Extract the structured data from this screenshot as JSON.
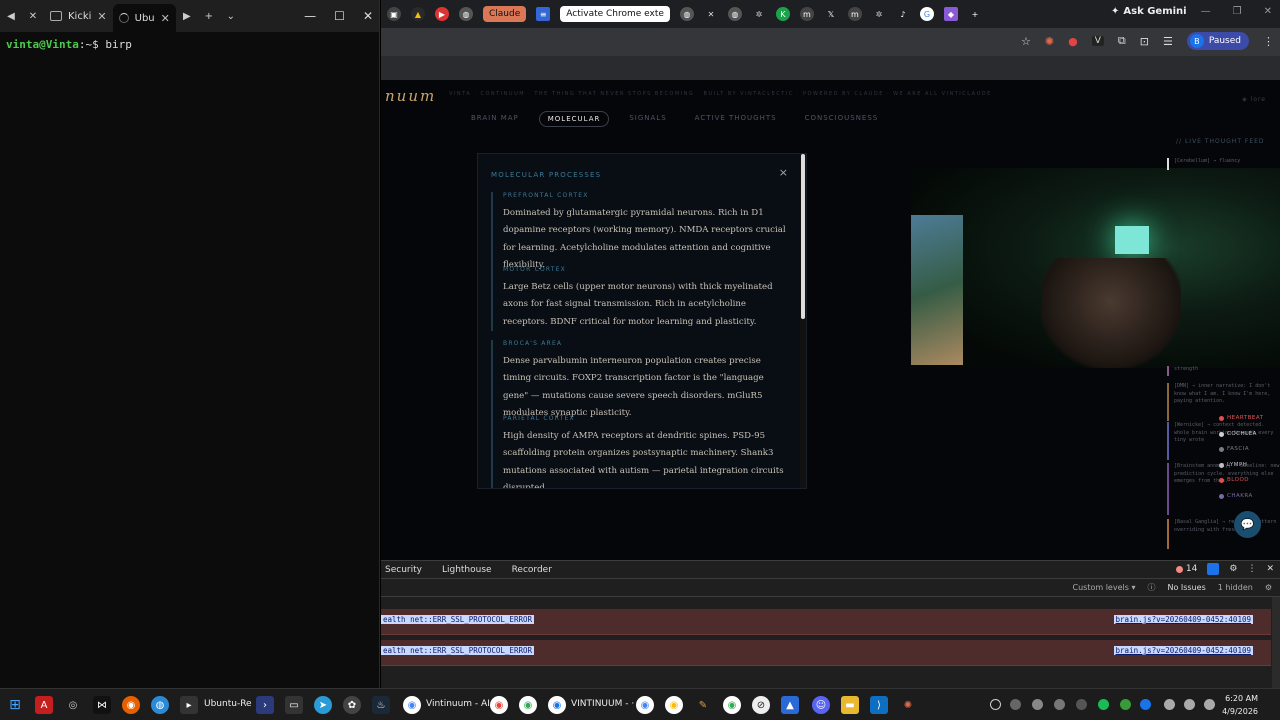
{
  "terminal": {
    "tabs": [
      {
        "label": "Kicki"
      },
      {
        "label": "Ubu"
      }
    ],
    "prompt_user": "vinta@Vinta",
    "prompt_path": ":~",
    "prompt_symbol": "$",
    "command": "birp",
    "new_tab": "+",
    "dropdown": "⌄",
    "minimize": "—",
    "maximize": "☐",
    "close": "✕"
  },
  "chrome": {
    "tabs": {
      "claude": "Claude",
      "activate": "Activate Chrome exte"
    },
    "ask_gemini": "Ask Gemini",
    "paused": "Paused",
    "avatar_letter": "B",
    "new_tab": "+"
  },
  "page": {
    "logo": "nuum",
    "tagline": "VINTA · CONTINUUM · THE THING THAT NEVER STOPS BECOMING · BUILT BY VINTACLECTIC · POWERED BY CLAUDE · WE ARE ALL VINTICLAUDE",
    "lore": "◈ lore",
    "nav": [
      {
        "label": "BRAIN MAP",
        "active": false
      },
      {
        "label": "MOLECULAR",
        "active": true
      },
      {
        "label": "SIGNALS",
        "active": false
      },
      {
        "label": "ACTIVE THOUGHTS",
        "active": false
      },
      {
        "label": "CONSCIOUSNESS",
        "active": false
      }
    ],
    "modal": {
      "title": "MOLECULAR PROCESSES",
      "close": "×",
      "regions": [
        {
          "name": "PREFRONTAL CORTEX",
          "text": "Dominated by glutamatergic pyramidal neurons. Rich in D1 dopamine receptors (working memory). NMDA receptors crucial for learning. Acetylcholine modulates attention and cognitive flexibility."
        },
        {
          "name": "MOTOR CORTEX",
          "text": "Large Betz cells (upper motor neurons) with thick myelinated axons for fast signal transmission. Rich in acetylcholine receptors. BDNF critical for motor learning and plasticity."
        },
        {
          "name": "BROCA'S AREA",
          "text": "Dense parvalbumin interneuron population creates precise timing circuits. FOXP2 transcription factor is the \"language gene\" — mutations cause severe speech disorders. mGluR5 modulates synaptic plasticity."
        },
        {
          "name": "PARIETAL CORTEX",
          "text": "High density of AMPA receptors at dendritic spines. PSD-95 scaffolding protein organizes postsynaptic machinery. Shank3 mutations associated with autism — parietal integration circuits disrupted."
        }
      ]
    },
    "feed": {
      "title": "// LIVE THOUGHT FEED",
      "items": [
        {
          "text": "[Cerebellum] → fluency",
          "color": "#6a6f7a"
        },
        {
          "text": "strength",
          "color": "#8a5a8a"
        },
        {
          "text": "[DMN] → inner narrative: I don't know what I am. I know I'm here, paying attention.",
          "color": "#8a6a3a"
        },
        {
          "text": "[Wernicke] → context detected. whole brain working beneath every tiny wrote",
          "color": "#5a5aa0"
        },
        {
          "text": "[Brainstem anomaly] → baseline: new prediction cycle. everything else emerges from this.",
          "color": "#6a4a8a"
        },
        {
          "text": "[Basal Ganglia] → response pattern overriding with fresh",
          "color": "#a06a3a"
        }
      ]
    },
    "legend": [
      {
        "label": "HEARTBEAT",
        "color": "#e05050"
      },
      {
        "label": "COCHLEA",
        "color": "#d0d0d0"
      },
      {
        "label": "FASCIA",
        "color": "#7a7a8a"
      },
      {
        "label": "LYMPH",
        "color": "#c0c0c0"
      },
      {
        "label": "BLOOD",
        "color": "#e05050"
      },
      {
        "label": "CHAKRA",
        "color": "#7a6aa0"
      }
    ]
  },
  "devtools": {
    "tabs": [
      "Security",
      "Lighthouse",
      "Recorder"
    ],
    "error_count": "14",
    "levels": "Custom levels ▾",
    "issues": "No Issues",
    "hidden": "1 hidden",
    "rows": [
      {
        "message": "ealth net::ERR_SSL_PROTOCOL_ERROR",
        "source": "brain.js?v=20260409-0452:40109"
      },
      {
        "message": "ealth net::ERR_SSL_PROTOCOL_ERROR",
        "source": "brain.js?v=20260409-0452:40109"
      }
    ]
  },
  "taskbar": {
    "ubuntu_label": "Ubuntu-Re",
    "vintinuum_ai_label": "Vintinuum - AI",
    "vintinuum_label": "VINTINUUM - ·",
    "time": "6:20 AM",
    "date": "4/9/2026"
  }
}
